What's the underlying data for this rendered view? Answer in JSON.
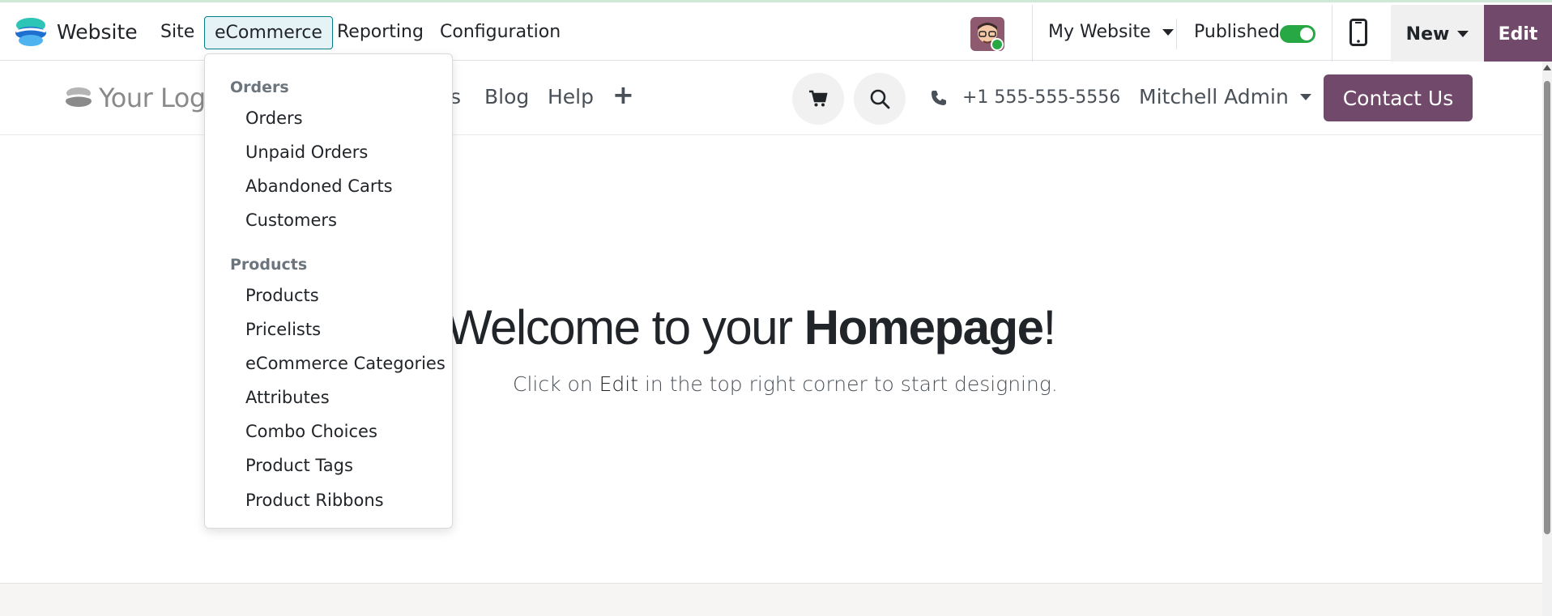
{
  "topbar": {
    "app_name": "Website",
    "menu": [
      "Site",
      "eCommerce",
      "Reporting",
      "Configuration"
    ],
    "website_selector": "My Website",
    "published_label": "Published",
    "published": true,
    "new_label": "New",
    "edit_label": "Edit"
  },
  "site_header": {
    "logo_text": "Your Logo",
    "nav": [
      "s",
      "Blog",
      "Help"
    ],
    "plus": "+",
    "phone": "+1 555-555-5556",
    "user": "Mitchell Admin",
    "contact_label": "Contact Us"
  },
  "main": {
    "welcome_prefix": "Welcome to your ",
    "welcome_bold": "Homepage",
    "welcome_suffix": "!",
    "sub_prefix": "Click on ",
    "sub_strong": "Edit",
    "sub_suffix": " in the top right corner to start designing."
  },
  "dropdown": {
    "orders_header": "Orders",
    "orders_items": [
      "Orders",
      "Unpaid Orders",
      "Abandoned Carts",
      "Customers"
    ],
    "products_header": "Products",
    "products_items": [
      "Products",
      "Pricelists",
      "eCommerce Categories",
      "Attributes",
      "Combo Choices",
      "Product Tags",
      "Product Ribbons"
    ]
  },
  "colors": {
    "brand_purple": "#71496a",
    "active_teal": "#017e84",
    "toggle_green": "#28a745"
  }
}
